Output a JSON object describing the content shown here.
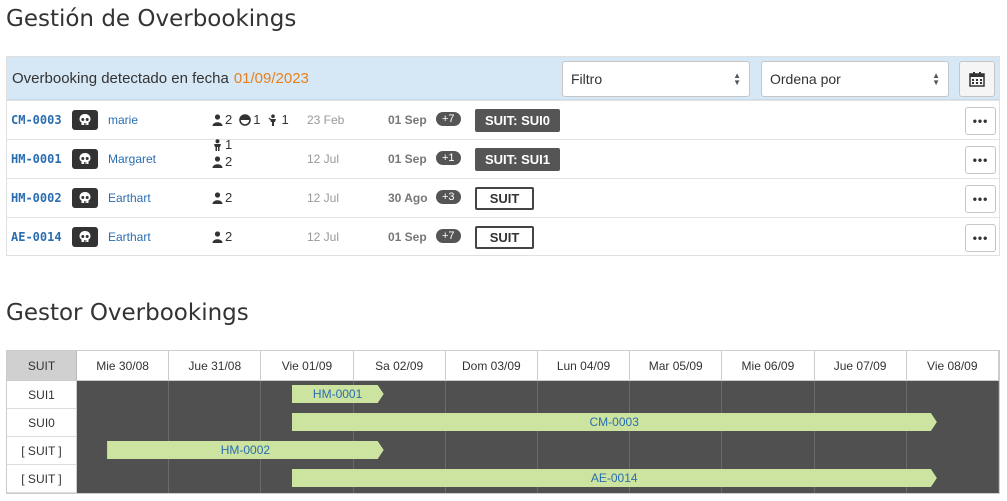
{
  "title": "Gestión de Overbookings",
  "panel": {
    "detected_label": "Overbooking detectado en fecha",
    "detected_date": "01/09/2023",
    "filter_label": "Filtro",
    "order_label": "Ordena por"
  },
  "bookings": [
    {
      "code": "CM-0003",
      "name": "marie",
      "adults": "2",
      "children": "1",
      "babies": "1",
      "extra": "",
      "arrival": "23 Feb",
      "departure": "01 Sep",
      "nights": "+7",
      "room": "SUIT: SUI0",
      "room_style": "dark"
    },
    {
      "code": "HM-0001",
      "name": "Margaret",
      "adults": "2",
      "children": "",
      "babies": "",
      "extra": "1",
      "arrival": "12 Jul",
      "departure": "01 Sep",
      "nights": "+1",
      "room": "SUIT: SUI1",
      "room_style": "dark"
    },
    {
      "code": "HM-0002",
      "name": "Earthart",
      "adults": "2",
      "children": "",
      "babies": "",
      "extra": "",
      "arrival": "12 Jul",
      "departure": "30 Ago",
      "nights": "+3",
      "room": "SUIT",
      "room_style": "light"
    },
    {
      "code": "AE-0014",
      "name": "Earthart",
      "adults": "2",
      "children": "",
      "babies": "",
      "extra": "",
      "arrival": "12 Jul",
      "departure": "01 Sep",
      "nights": "+7",
      "room": "SUIT",
      "room_style": "light"
    }
  ],
  "gantt": {
    "title": "Gestor Overbookings",
    "corner": "SUIT",
    "days": [
      "Mie 30/08",
      "Jue 31/08",
      "Vie 01/09",
      "Sa 02/09",
      "Dom 03/09",
      "Lun 04/09",
      "Mar 05/09",
      "Mie 06/09",
      "Jue 07/09",
      "Vie 08/09"
    ],
    "rows": [
      {
        "label": "SUI1",
        "bar": "HM-0001",
        "start_day": 2.5,
        "end_day": 3.5
      },
      {
        "label": "SUI0",
        "bar": "CM-0003",
        "start_day": 2.5,
        "end_day": 9.5
      },
      {
        "label": "[ SUIT ]",
        "bar": "HM-0002",
        "start_day": 0.5,
        "end_day": 3.5
      },
      {
        "label": "[ SUIT ]",
        "bar": "AE-0014",
        "start_day": 2.5,
        "end_day": 9.5
      }
    ]
  }
}
